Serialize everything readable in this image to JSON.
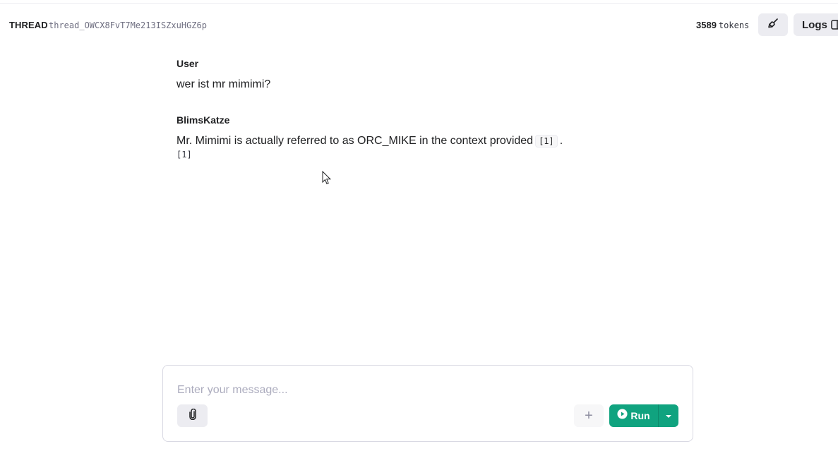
{
  "header": {
    "thread_label": "THREAD",
    "thread_id": "thread_OWCX8FvT7Me213ISZxuHGZ6p",
    "tokens_count": "3589",
    "tokens_unit": "tokens",
    "logs_label": "Logs"
  },
  "messages": [
    {
      "role": "User",
      "text": "wer ist mr mimimi?"
    },
    {
      "role": "BlimsKatze",
      "text_before": "Mr. Mimimi is actually referred to as ORC_MIKE in the context provided",
      "citation": "[1]",
      "text_after": ".",
      "annotation": "[1]"
    }
  ],
  "composer": {
    "placeholder": "Enter your message...",
    "add_label": "+",
    "run_label": "Run"
  },
  "icons": {
    "clean": "broom-icon",
    "logs": "panel-icon",
    "attach": "paperclip-icon",
    "run": "play-icon",
    "dropdown": "caret-down-icon"
  },
  "colors": {
    "accent": "#10a37f",
    "button_bg": "#ececf1",
    "text": "#202123",
    "muted": "#6e6e80"
  }
}
